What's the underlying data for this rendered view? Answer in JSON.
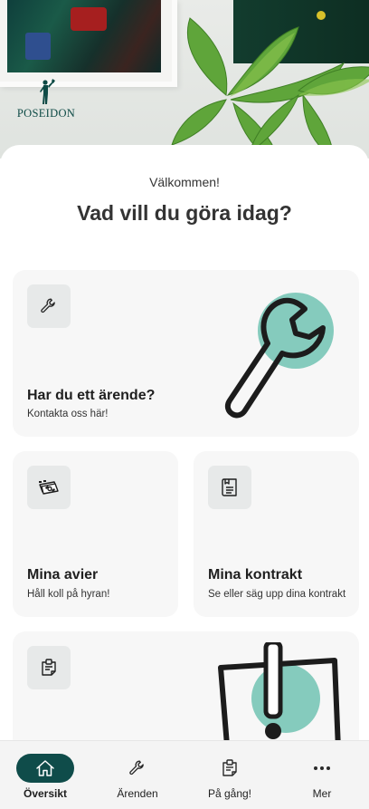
{
  "brand": {
    "name": "POSEIDON"
  },
  "greeting": {
    "welcome": "Välkommen!",
    "headline": "Vad vill du göra idag?"
  },
  "cards": [
    {
      "id": "errand",
      "icon": "wrench-icon",
      "title": "Har du ett ärende?",
      "subtitle": "Kontakta oss här!"
    },
    {
      "id": "notices",
      "icon": "money-icon",
      "title": "Mina avier",
      "subtitle": "Håll koll på hyran!"
    },
    {
      "id": "contracts",
      "icon": "document-icon",
      "title": "Mina kontrakt",
      "subtitle": "Se eller säg upp dina kontrakt"
    },
    {
      "id": "news",
      "icon": "clipboard-icon"
    }
  ],
  "bottom_nav": [
    {
      "label": "Översikt",
      "icon": "home-icon",
      "active": true
    },
    {
      "label": "Ärenden",
      "icon": "wrench-icon",
      "active": false
    },
    {
      "label": "På gång!",
      "icon": "clipboard-icon",
      "active": false
    },
    {
      "label": "Mer",
      "icon": "more-icon",
      "active": false
    }
  ],
  "colors": {
    "brand_dark": "#0f4c4a",
    "accent_mint": "#85cbbd",
    "card_bg": "#f7f7f7",
    "icon_tile_bg": "#e7e9e9"
  }
}
